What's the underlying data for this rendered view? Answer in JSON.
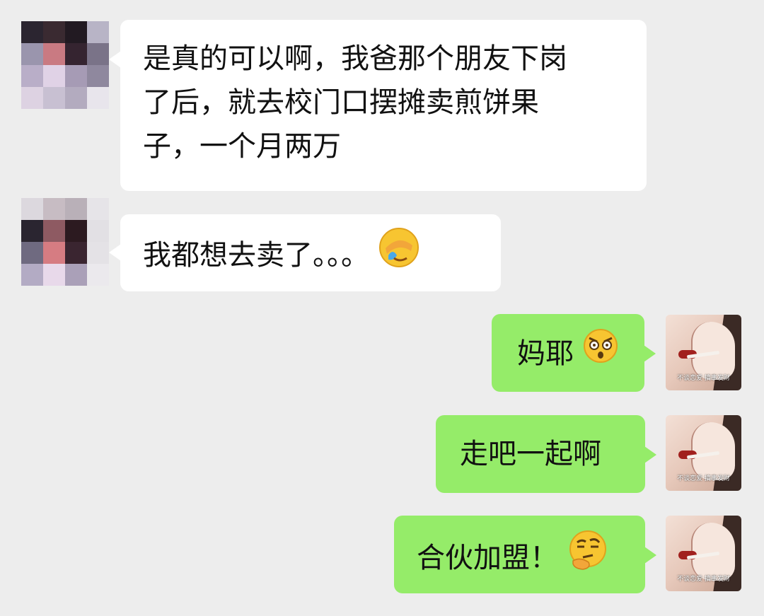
{
  "messages": [
    {
      "side": "left",
      "lines": [
        "是真的可以啊，我爸那个朋友下岗",
        "了后，就去校门口摆摊卖煎饼果",
        "子，一个月两万"
      ]
    },
    {
      "side": "left",
      "text": "我都想去卖了。。。",
      "emoji": "facepalm-laughing-emoji"
    },
    {
      "side": "right",
      "text": "妈耶",
      "emoji": "shocked-face-emoji"
    },
    {
      "side": "right",
      "text": "走吧一起啊"
    },
    {
      "side": "right",
      "text": "合伙加盟！",
      "emoji": "thinking-face-emoji"
    }
  ],
  "my_avatar": {
    "caption": "不谈恋爱 搞事发财"
  },
  "colors": {
    "background": "#ededed",
    "incoming_bubble": "#ffffff",
    "outgoing_bubble": "#95ec69",
    "emoji_yellow": "#f7c531"
  }
}
